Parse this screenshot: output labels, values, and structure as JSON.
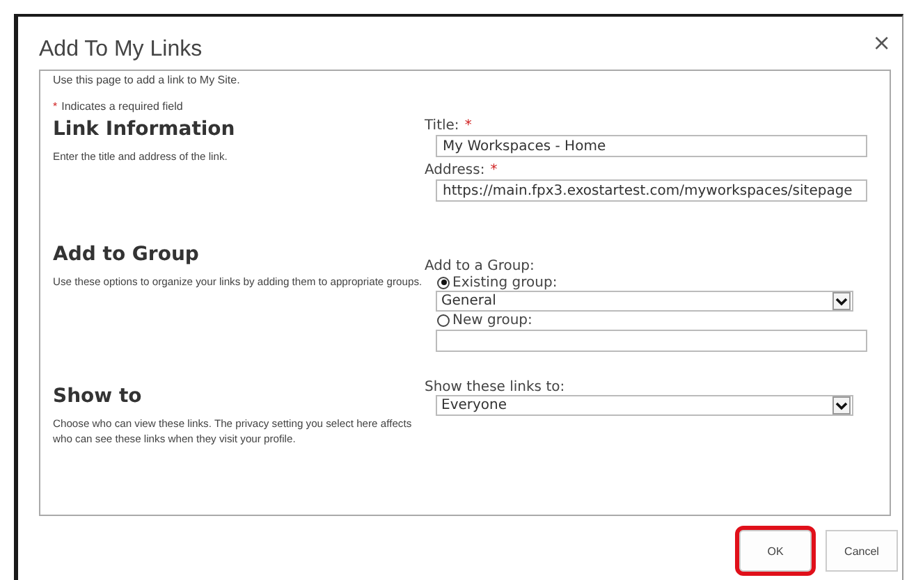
{
  "dialog": {
    "title": "Add To My Links",
    "close": "×"
  },
  "intro": "Use this page to add a link to My Site.",
  "required_note": {
    "mark": "*",
    "text": "Indicates a required field"
  },
  "sections": [
    {
      "heading": "Link Information",
      "description": "Enter the title and address of the link.",
      "fields": [
        {
          "kind": "text",
          "label": "Title:",
          "required": true,
          "value": "My Workspaces - Home"
        },
        {
          "kind": "text",
          "label": "Address:",
          "required": true,
          "value": "https://main.fpx3.exostartest.com/myworkspaces/sitepage"
        }
      ]
    },
    {
      "heading": "Add to Group",
      "description": "Use these options to organize your links by adding them to appropriate groups.",
      "fields": [
        {
          "kind": "label",
          "label": "Add to a Group:"
        },
        {
          "kind": "radio",
          "label": "Existing group:",
          "selected": true
        },
        {
          "kind": "select",
          "value": "General"
        },
        {
          "kind": "radio",
          "label": "New group:",
          "selected": false
        },
        {
          "kind": "text"
        }
      ]
    },
    {
      "heading": "Show to",
      "description": "Choose who can view these links. The privacy setting you select here affects who can see these links when they visit your profile.",
      "fields": [
        {
          "kind": "select",
          "label": "Show these links to:",
          "value": "Everyone"
        }
      ]
    }
  ],
  "buttons": [
    {
      "label": "OK",
      "highlighted": true
    },
    {
      "label": "Cancel",
      "highlighted": false
    }
  ]
}
